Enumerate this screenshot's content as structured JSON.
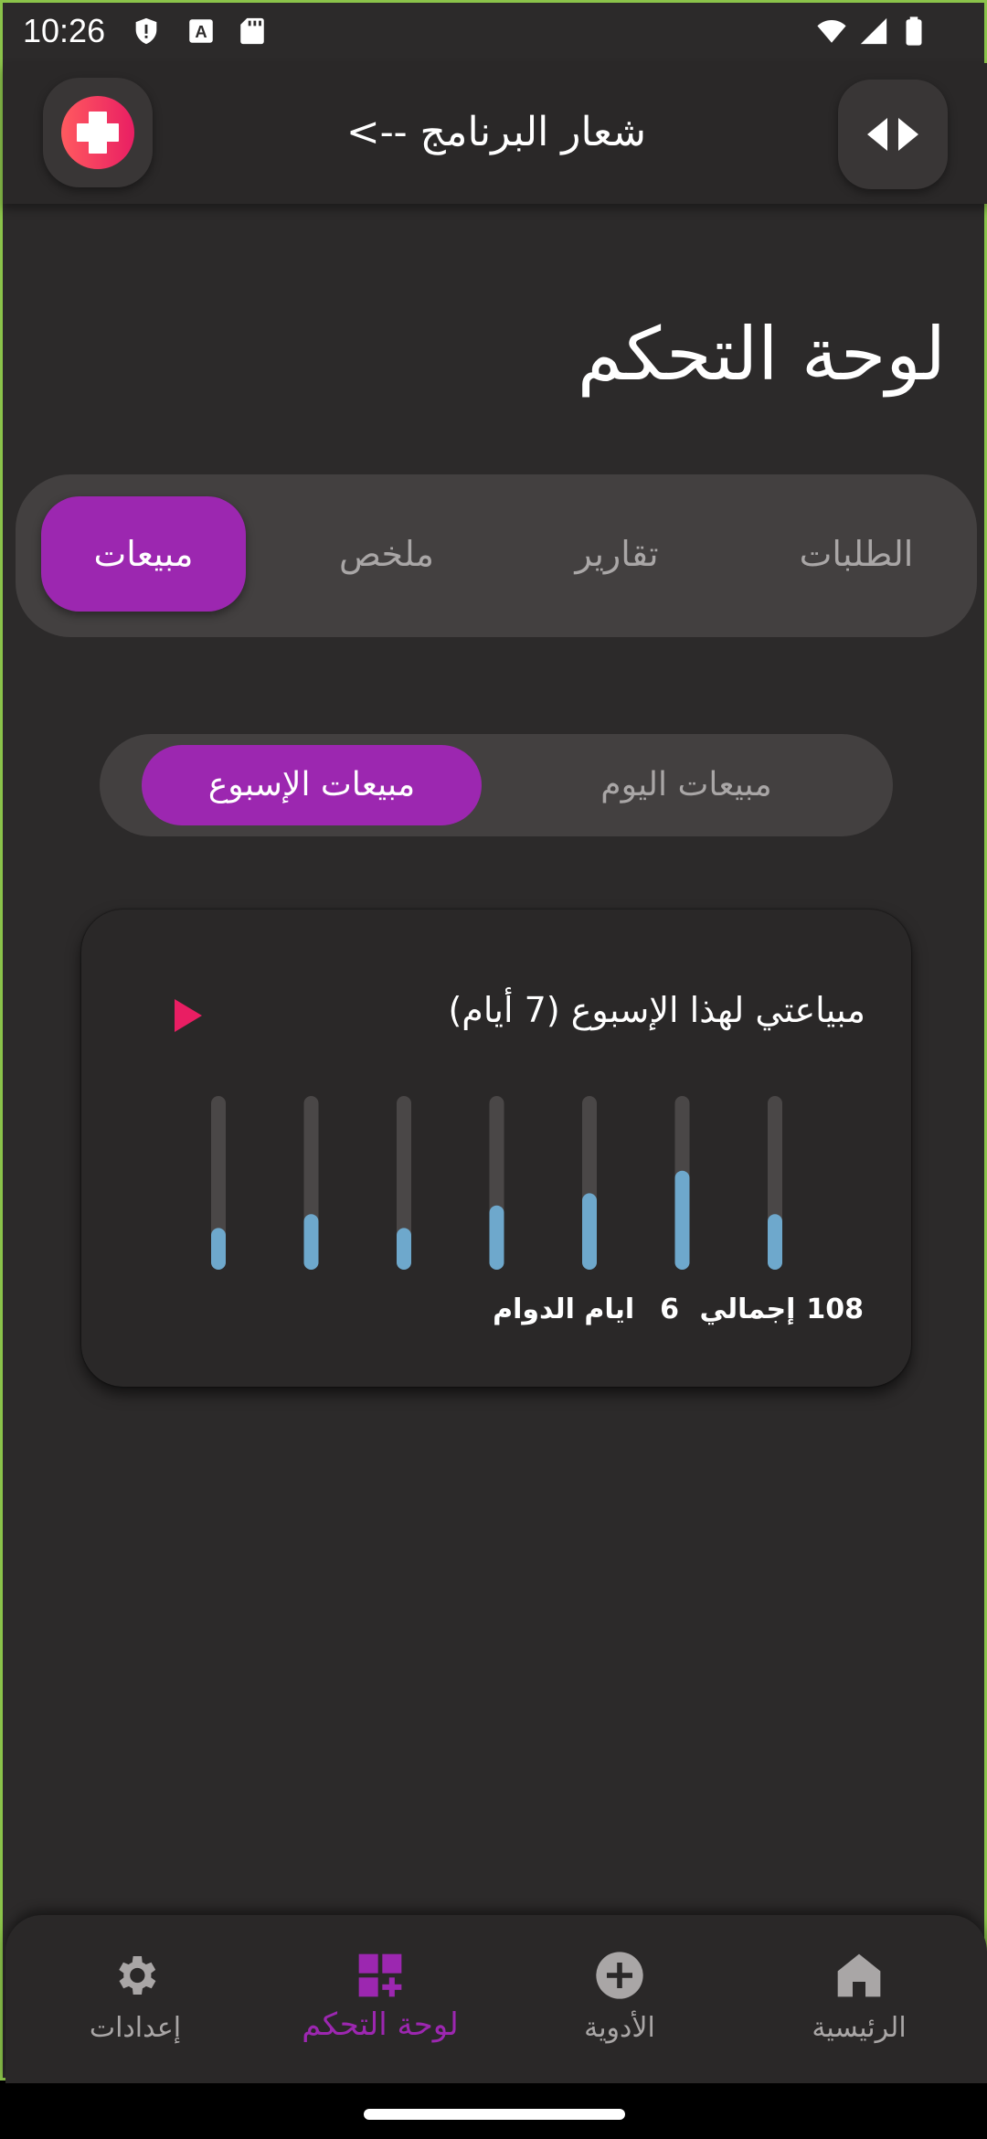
{
  "status_bar": {
    "time": "10:26",
    "icons": [
      "shield-icon",
      "text-a-icon",
      "sd-card-icon",
      "wifi-icon",
      "signal-icon",
      "battery-icon"
    ]
  },
  "app_bar": {
    "title": "شعار البرنامج -->",
    "logo_icon": "medical-cross-icon",
    "swap_icon": "swap-arrows-icon"
  },
  "page": {
    "title": "لوحة التحكم"
  },
  "tabs": [
    {
      "label": "مبيعات",
      "active": true
    },
    {
      "label": "ملخص",
      "active": false
    },
    {
      "label": "تقارير",
      "active": false
    },
    {
      "label": "الطلبات",
      "active": false
    }
  ],
  "sales_toggle": [
    {
      "label": "مبيعات الإسبوع",
      "active": true
    },
    {
      "label": "مبيعات اليوم",
      "active": false
    }
  ],
  "card": {
    "title": "مبياعتي لهذا الإسبوع  (7  أيام)",
    "total_value": "108",
    "total_label": "إجمالي",
    "days_value": "6",
    "days_label": "ايام الدوام"
  },
  "chart_data": {
    "type": "bar",
    "values": [
      0.24,
      0.32,
      0.24,
      0.37,
      0.44,
      0.57,
      0.32
    ],
    "ylim": [
      0,
      1
    ],
    "colors": {
      "fill": "#6ea8cc",
      "track": "#4a4747"
    }
  },
  "bottom_nav": [
    {
      "label": "إعدادات",
      "icon": "gear-icon",
      "active": false
    },
    {
      "label": "لوحة التحكم",
      "icon": "dashboard-add-icon",
      "active": true
    },
    {
      "label": "الأدوية",
      "icon": "plus-circle-icon",
      "active": false
    },
    {
      "label": "الرئيسية",
      "icon": "home-icon",
      "active": false
    }
  ],
  "colors": {
    "accent": "#9c27b0",
    "background": "#2c2a2a",
    "surface": "#434040",
    "pink": "#e91e63",
    "bar": "#6ea8cc"
  }
}
